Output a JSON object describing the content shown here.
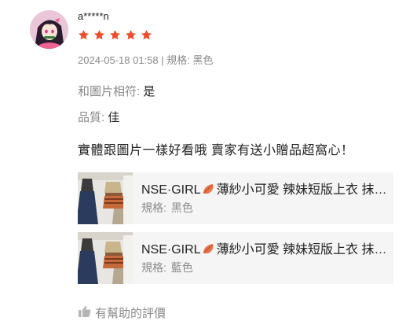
{
  "review": {
    "username": "a*****n",
    "rating": 5,
    "star_color": "#ee4d2d",
    "datetime": "2024-05-18 01:58",
    "separator": "|",
    "variation_label": "規格:",
    "variation_value": "黑色"
  },
  "attributes": [
    {
      "key": "和圖片相符:",
      "value": "是"
    },
    {
      "key": "品質:",
      "value": "佳"
    }
  ],
  "comment": "實體跟圖片一樣好看哦 賣家有送小贈品超窩心！",
  "products": [
    {
      "name_prefix": "NSE·GIRL",
      "name_suffix": "薄紗小可愛 辣妹短版上衣 抹胸 平口",
      "spec_label": "規格:",
      "spec_value": "黑色"
    },
    {
      "name_prefix": "NSE·GIRL",
      "name_suffix": "薄紗小可愛 辣妹短版上衣 抹胸 平口",
      "spec_label": "規格:",
      "spec_value": "藍色"
    }
  ],
  "helpful_label": "有幫助的評價",
  "icons": {
    "avatar": "anime-girl-avatar",
    "star": "star-icon",
    "leaf": "leaf-icon",
    "thumbs_up": "thumbs-up-icon"
  }
}
